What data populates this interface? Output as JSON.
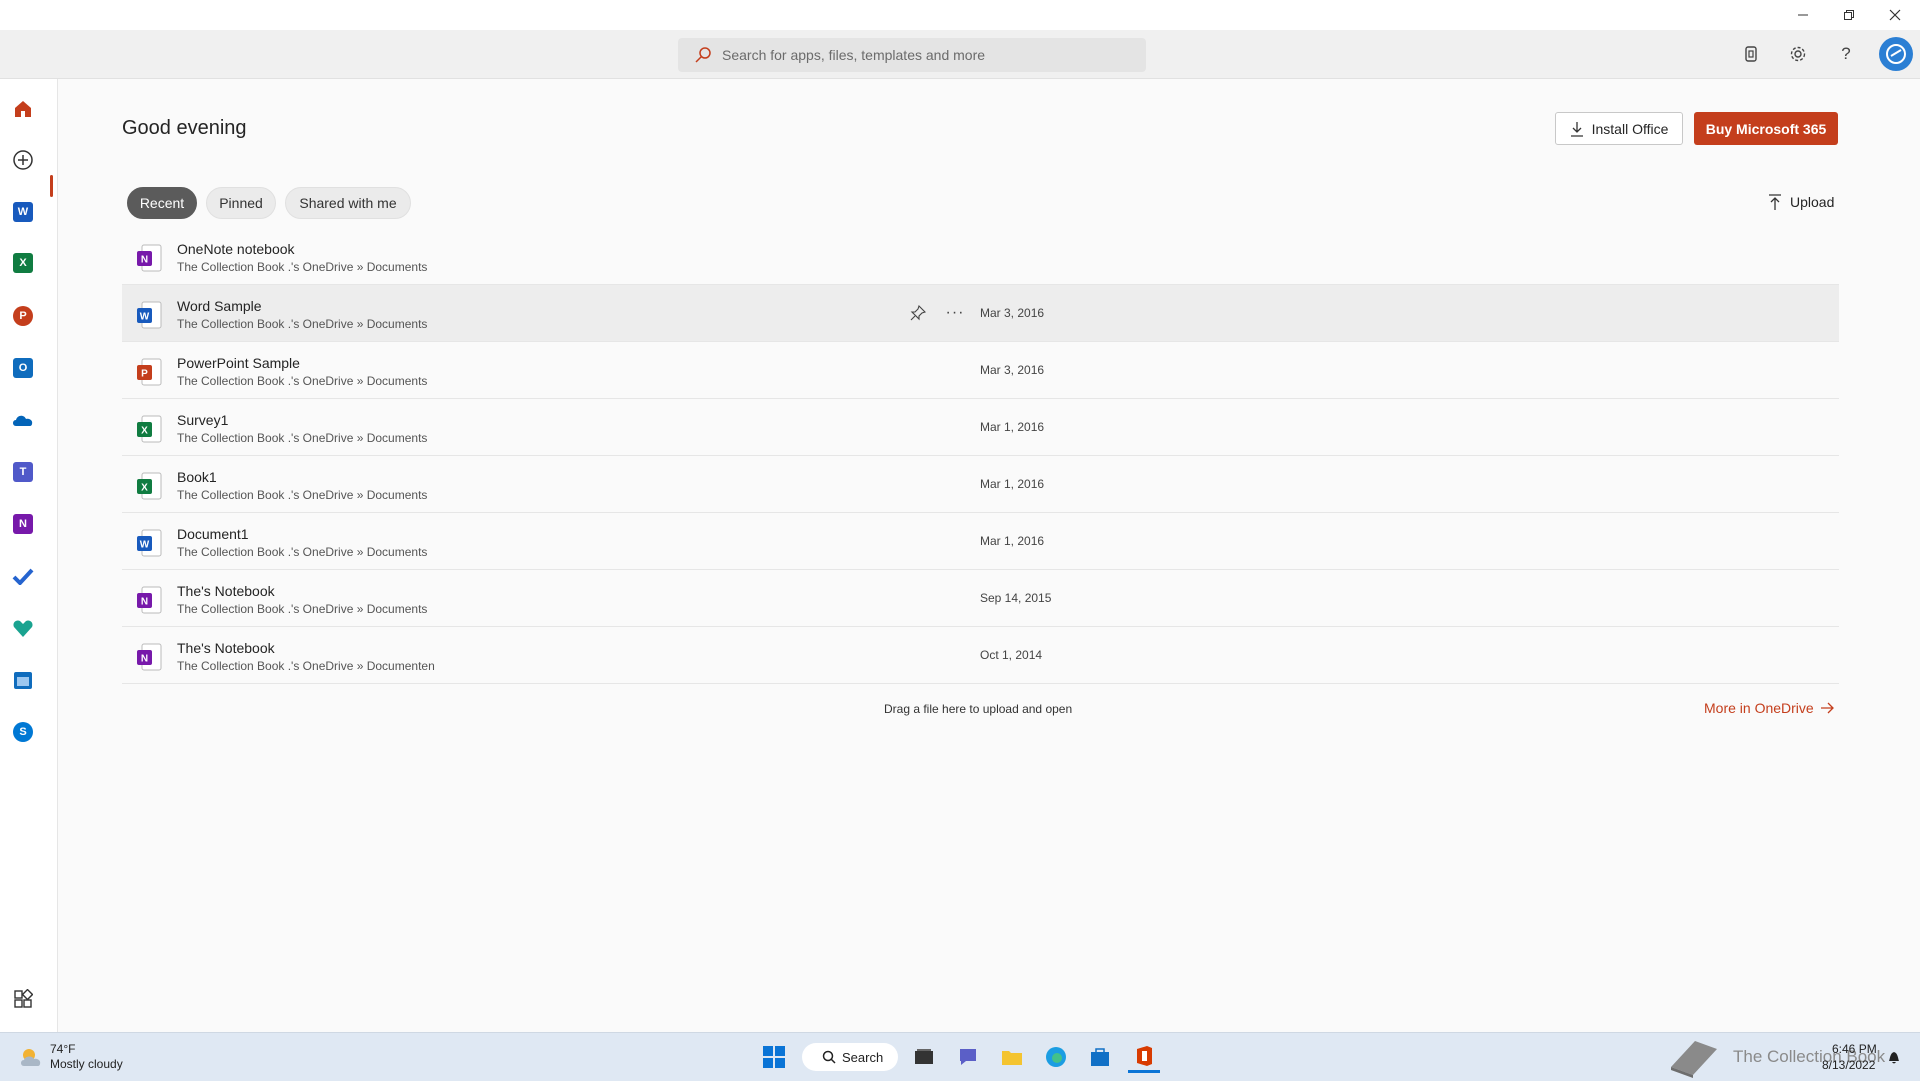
{
  "titlebar": {
    "minimize": "—",
    "restore": "❐",
    "close": "✕"
  },
  "header": {
    "search_placeholder": "Search for apps, files, templates and more"
  },
  "rail": {
    "items": [
      {
        "name": "Home",
        "icon": "home-icon"
      },
      {
        "name": "Create",
        "icon": "plus-circle-icon"
      },
      {
        "name": "Word",
        "icon": "word-icon",
        "color": "#185abd",
        "letter": "W"
      },
      {
        "name": "Excel",
        "icon": "excel-icon",
        "color": "#107c41",
        "letter": "X"
      },
      {
        "name": "PowerPoint",
        "icon": "powerpoint-icon",
        "color": "#c43e1c",
        "letter": "P"
      },
      {
        "name": "Outlook",
        "icon": "outlook-icon",
        "color": "#0f6cbd",
        "letter": "O"
      },
      {
        "name": "OneDrive",
        "icon": "onedrive-icon",
        "color": "#0364b8"
      },
      {
        "name": "Teams",
        "icon": "teams-icon",
        "color": "#5059c9"
      },
      {
        "name": "OneNote",
        "icon": "onenote-icon",
        "color": "#7719aa",
        "letter": "N"
      },
      {
        "name": "To Do",
        "icon": "todo-icon",
        "color": "#2564cf"
      },
      {
        "name": "Family Safety",
        "icon": "family-safety-icon",
        "color": "#1aa390"
      },
      {
        "name": "Calendar",
        "icon": "calendar-icon",
        "color": "#0f6cbd"
      },
      {
        "name": "Skype",
        "icon": "skype-icon",
        "color": "#0078d4",
        "letter": "S"
      }
    ]
  },
  "main": {
    "greeting": "Good evening",
    "install_label": "Install Office",
    "buy_label": "Buy Microsoft 365",
    "tabs": [
      {
        "label": "Recent",
        "active": true
      },
      {
        "label": "Pinned",
        "active": false
      },
      {
        "label": "Shared with me",
        "active": false
      }
    ],
    "upload_label": "Upload",
    "files": [
      {
        "name": "OneNote notebook",
        "path": "The Collection Book .'s OneDrive » Documents",
        "date": "",
        "type": "onenote"
      },
      {
        "name": "Word Sample",
        "path": "The Collection Book .'s OneDrive » Documents",
        "date": "Mar 3, 2016",
        "type": "word",
        "hover": true
      },
      {
        "name": "PowerPoint Sample",
        "path": "The Collection Book .'s OneDrive » Documents",
        "date": "Mar 3, 2016",
        "type": "powerpoint"
      },
      {
        "name": "Survey1",
        "path": "The Collection Book .'s OneDrive » Documents",
        "date": "Mar 1, 2016",
        "type": "excel"
      },
      {
        "name": "Book1",
        "path": "The Collection Book .'s OneDrive » Documents",
        "date": "Mar 1, 2016",
        "type": "excel"
      },
      {
        "name": "Document1",
        "path": "The Collection Book .'s OneDrive » Documents",
        "date": "Mar 1, 2016",
        "type": "word"
      },
      {
        "name": "The's Notebook",
        "path": "The Collection Book .'s OneDrive » Documents",
        "date": "Sep 14, 2015",
        "type": "onenote"
      },
      {
        "name": "The's Notebook",
        "path": "The Collection Book .'s OneDrive » Documenten",
        "date": "Oct 1, 2014",
        "type": "onenote"
      }
    ],
    "drop_note": "Drag a file here to upload and open",
    "more_onedrive": "More in OneDrive"
  },
  "taskbar": {
    "weather_temp": "74°F",
    "weather_desc": "Mostly cloudy",
    "search_label": "Search",
    "time": "6:46 PM",
    "date": "8/13/2022",
    "watermark": "The Collection Book"
  },
  "colors": {
    "accent": "#c43e1c",
    "word": "#185abd",
    "excel": "#107c41",
    "powerpoint": "#c43e1c",
    "onenote": "#7719aa"
  }
}
